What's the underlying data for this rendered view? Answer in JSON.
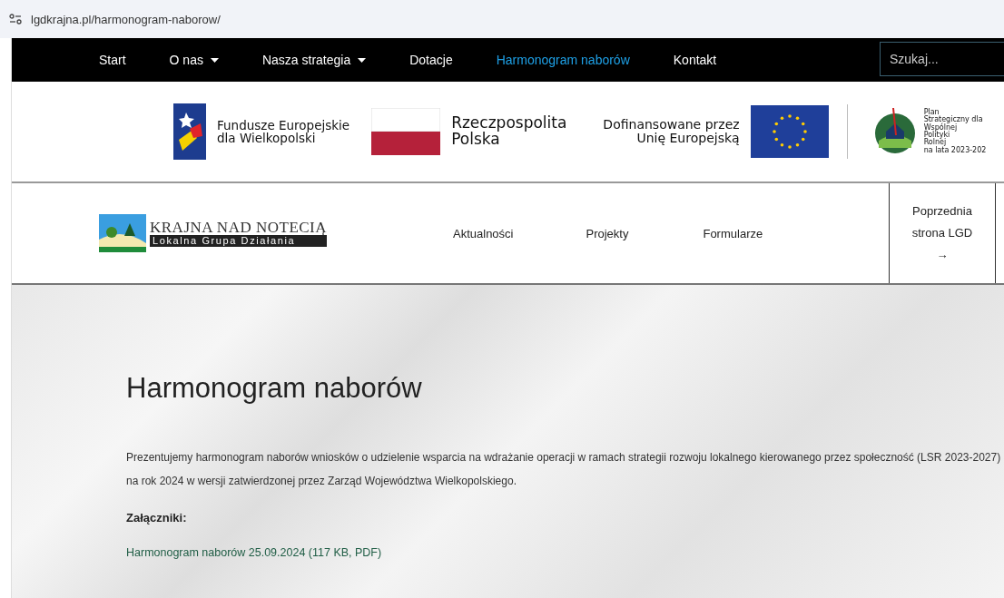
{
  "browser": {
    "url": "lgdkrajna.pl/harmonogram-naborow/"
  },
  "top_nav": {
    "items": [
      {
        "label": "Start",
        "dropdown": false,
        "selected": false
      },
      {
        "label": "O nas",
        "dropdown": true,
        "selected": false
      },
      {
        "label": "Nasza strategia",
        "dropdown": true,
        "selected": false
      },
      {
        "label": "Dotacje",
        "dropdown": false,
        "selected": false
      },
      {
        "label": "Harmonogram naborów",
        "dropdown": false,
        "selected": true
      },
      {
        "label": "Kontakt",
        "dropdown": false,
        "selected": false
      }
    ],
    "search": {
      "placeholder": "Szukaj..."
    }
  },
  "funding_bar": {
    "fe": "Fundusze Europejskie\ndla Wielkopolski",
    "rp": "Rzeczpospolita\nPolska",
    "eu": "Dofinansowane przez\nUnię Europejską",
    "ps": "Plan\nStrategiczny dla\nWspólnej\nPolityki\nRolnej\nna lata 2023-202"
  },
  "header": {
    "logo_title": "KRAJNA NAD NOTECIĄ",
    "logo_subtitle": "Lokalna Grupa Działania",
    "menu": [
      "Aktualności",
      "Projekty",
      "Formularze"
    ],
    "prev_site": {
      "label": "Poprzednia\nstrona LGD",
      "arrow": "→"
    }
  },
  "content": {
    "title": "Harmonogram naborów",
    "intro": "Prezentujemy harmonogram naborów wniosków o udzielenie wsparcia na wdrażanie operacji w ramach strategii rozwoju lokalnego kierowanego przez społeczność (LSR 2023-2027) na rok 2024 w wersji zatwierdzonej przez Zarząd Województwa Wielkopolskiego.",
    "attachments_label": "Załączniki:",
    "attachments": [
      "Harmonogram naborów 25.09.2024 (117 KB, PDF)"
    ]
  }
}
